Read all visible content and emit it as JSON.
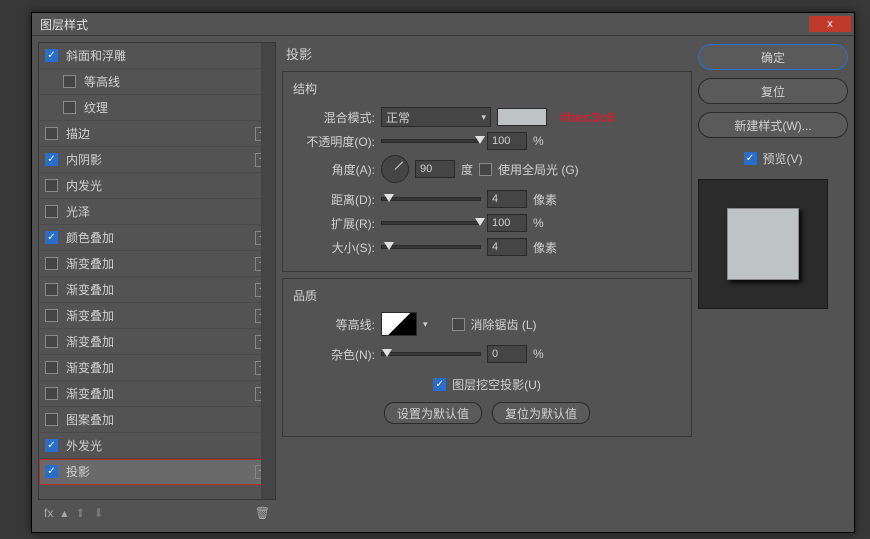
{
  "window": {
    "title": "图层样式"
  },
  "close_label": "x",
  "effects": [
    {
      "label": "斜面和浮雕",
      "checked": true,
      "has_add": false,
      "child": false
    },
    {
      "label": "等高线",
      "checked": false,
      "has_add": false,
      "child": true
    },
    {
      "label": "纹理",
      "checked": false,
      "has_add": false,
      "child": true
    },
    {
      "label": "描边",
      "checked": false,
      "has_add": true,
      "child": false
    },
    {
      "label": "内阴影",
      "checked": true,
      "has_add": true,
      "child": false
    },
    {
      "label": "内发光",
      "checked": false,
      "has_add": false,
      "child": false
    },
    {
      "label": "光泽",
      "checked": false,
      "has_add": false,
      "child": false
    },
    {
      "label": "颜色叠加",
      "checked": true,
      "has_add": true,
      "child": false
    },
    {
      "label": "渐变叠加",
      "checked": false,
      "has_add": true,
      "child": false
    },
    {
      "label": "渐变叠加",
      "checked": false,
      "has_add": true,
      "child": false
    },
    {
      "label": "渐变叠加",
      "checked": false,
      "has_add": true,
      "child": false
    },
    {
      "label": "渐变叠加",
      "checked": false,
      "has_add": true,
      "child": false
    },
    {
      "label": "渐变叠加",
      "checked": false,
      "has_add": true,
      "child": false
    },
    {
      "label": "渐变叠加",
      "checked": false,
      "has_add": true,
      "child": false
    },
    {
      "label": "图案叠加",
      "checked": false,
      "has_add": false,
      "child": false
    },
    {
      "label": "外发光",
      "checked": true,
      "has_add": false,
      "child": false
    },
    {
      "label": "投影",
      "checked": true,
      "has_add": true,
      "child": false,
      "selected": true
    }
  ],
  "footer_fx": "fx",
  "center": {
    "title": "投影",
    "group_structure": "结构",
    "blend_mode_label": "混合模式:",
    "blend_mode_value": "正常",
    "swatch_color": "#bec3c6",
    "annotation": "#bec3c6",
    "opacity_label": "不透明度(O):",
    "opacity_value": "100",
    "opacity_unit": "%",
    "angle_label": "角度(A):",
    "angle_value": "90",
    "angle_unit": "度",
    "global_light_label": "使用全局光 (G)",
    "distance_label": "距离(D):",
    "distance_value": "4",
    "distance_unit": "像素",
    "spread_label": "扩展(R):",
    "spread_value": "100",
    "spread_unit": "%",
    "size_label": "大小(S):",
    "size_value": "4",
    "size_unit": "像素",
    "group_quality": "品质",
    "contour_label": "等高线:",
    "antialias_label": "消除锯齿 (L)",
    "noise_label": "杂色(N):",
    "noise_value": "0",
    "noise_unit": "%",
    "knockout_label": "图层挖空投影(U)",
    "btn_set_default": "设置为默认值",
    "btn_reset_default": "复位为默认值"
  },
  "right": {
    "ok": "确定",
    "reset": "复位",
    "new_style": "新建样式(W)...",
    "preview_label": "预览(V)"
  }
}
